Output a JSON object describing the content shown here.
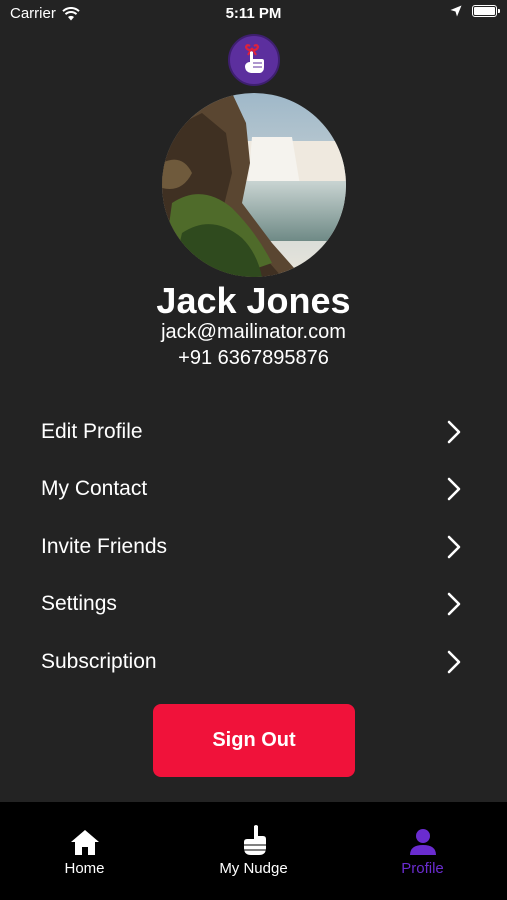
{
  "status_bar": {
    "carrier": "Carrier",
    "time": "5:11 PM",
    "battery_level": 1.0
  },
  "logo": {
    "icon": "pinky-promise-icon"
  },
  "profile": {
    "name": "Jack Jones",
    "email": "jack@mailinator.com",
    "phone": "+91 6367895876",
    "avatar_icon": "waterfall-photo"
  },
  "menu": {
    "items": [
      {
        "label": "Edit Profile"
      },
      {
        "label": "My Contact"
      },
      {
        "label": "Invite Friends"
      },
      {
        "label": "Settings"
      },
      {
        "label": "Subscription"
      }
    ],
    "chevron_icon": "chevron-right-icon"
  },
  "sign_out": {
    "label": "Sign Out",
    "color": "#f0123a"
  },
  "tab_bar": {
    "active_color": "#6a2ccf",
    "tabs": [
      {
        "label": "Home",
        "icon": "home-icon"
      },
      {
        "label": "My Nudge",
        "icon": "pointing-hand-icon"
      },
      {
        "label": "Profile",
        "icon": "person-icon",
        "active": true
      }
    ]
  },
  "colors": {
    "background": "#232323",
    "tab_bar_background": "#000000"
  }
}
